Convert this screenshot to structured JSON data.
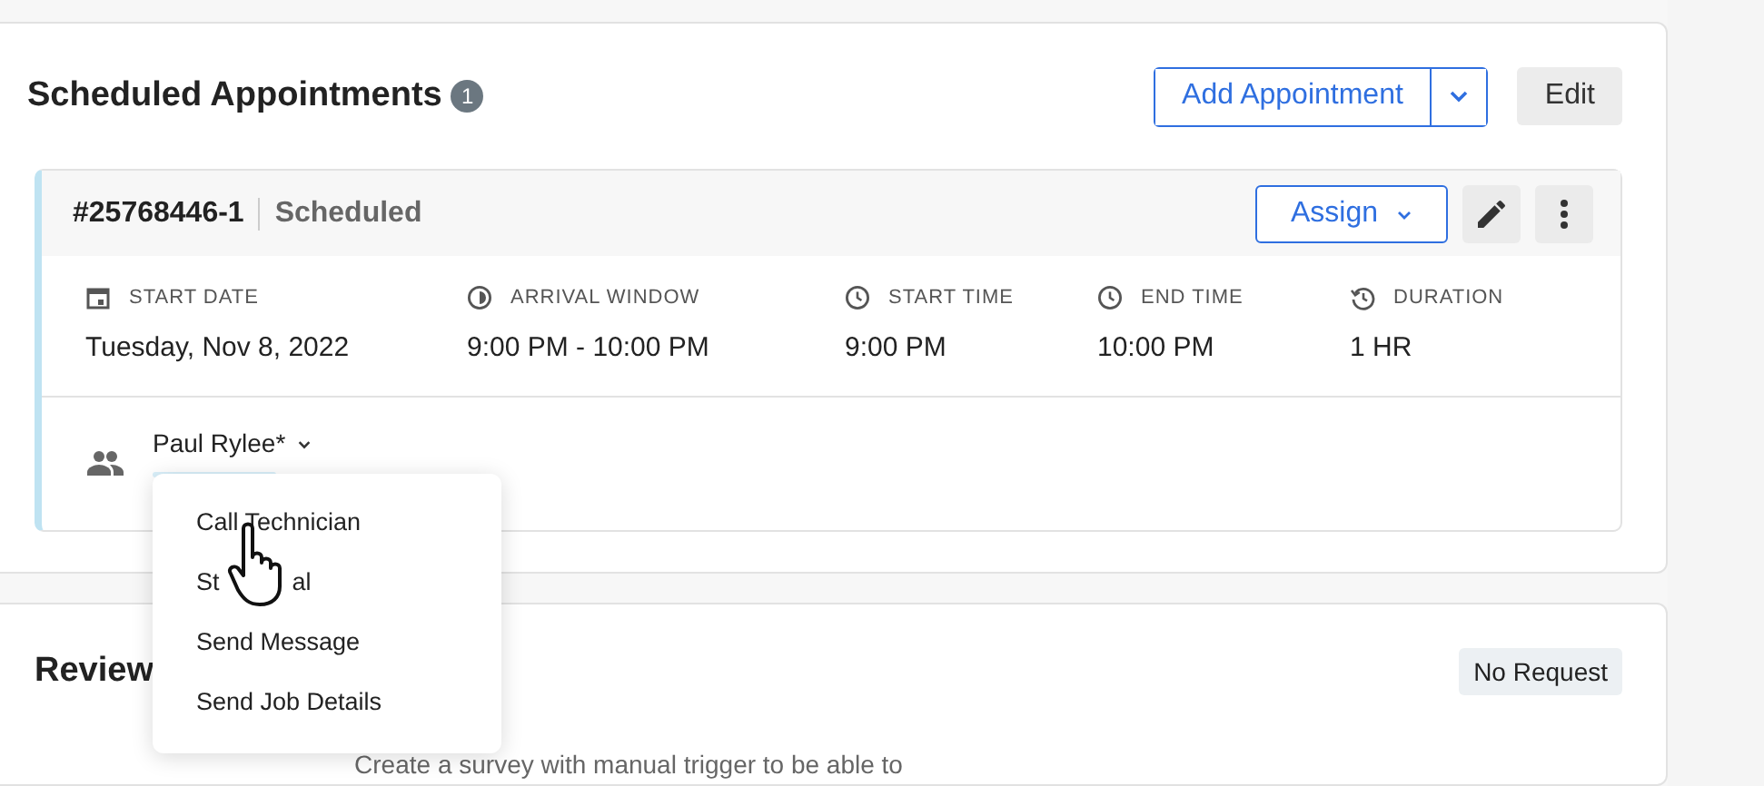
{
  "section": {
    "title": "Scheduled Appointments",
    "count": "1",
    "add_button": "Add Appointment",
    "edit_button": "Edit"
  },
  "appointment": {
    "number": "#25768446-1",
    "status": "Scheduled",
    "assign_button": "Assign",
    "fields": [
      {
        "kind": "calendar",
        "label": "START DATE",
        "value": "Tuesday, Nov 8, 2022"
      },
      {
        "kind": "window",
        "label": "ARRIVAL WINDOW",
        "value": "9:00 PM - 10:00 PM"
      },
      {
        "kind": "clock",
        "label": "START TIME",
        "value": "9:00 PM"
      },
      {
        "kind": "clock",
        "label": "END TIME",
        "value": "10:00 PM"
      },
      {
        "kind": "history",
        "label": "DURATION",
        "value": "1 HR"
      }
    ],
    "technician": "Paul Rylee*"
  },
  "menu": {
    "items": [
      {
        "label": "Call Technician"
      },
      {
        "label": "St",
        "label_end": "al"
      },
      {
        "label": "Send Message"
      },
      {
        "label": "Send Job Details"
      }
    ]
  },
  "review": {
    "title": "Review",
    "badge": "No Request",
    "text": "Create a survey with manual trigger to be able to"
  }
}
